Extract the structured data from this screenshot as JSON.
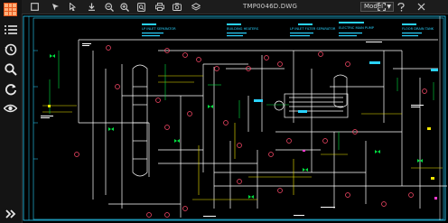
{
  "app": {
    "title": "TMP0046D.DWG"
  },
  "toolbar": {
    "view_select": "Model"
  },
  "drawing": {
    "labels": [
      "LP INLET SEPARATOR",
      "BUILDING HEATERS",
      "LP INLET FILTER SEPARATOR",
      "ELECTRIC MAIN PUMP",
      "FLOOR DRAIN TANK"
    ]
  },
  "colors": {
    "accent": "#e8581c",
    "canvas": "#000000",
    "frame": "#2ad3ff"
  }
}
